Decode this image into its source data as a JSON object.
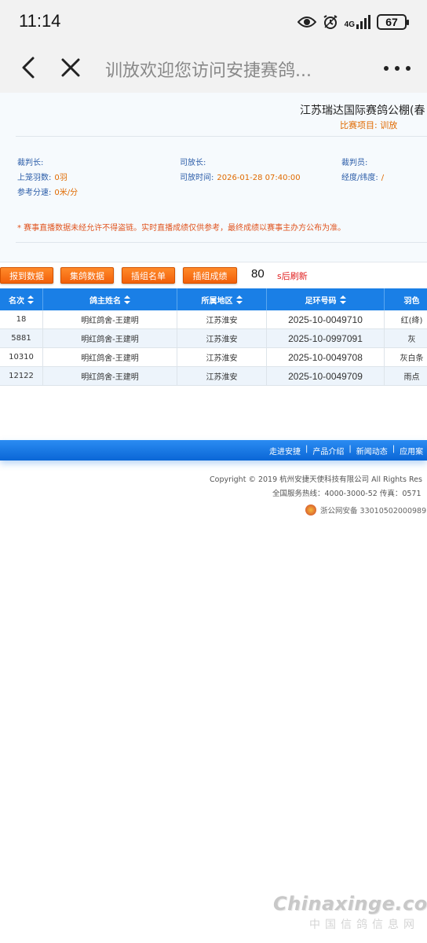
{
  "status_bar": {
    "time": "11:14",
    "network": "4G",
    "battery": "67"
  },
  "browser": {
    "title": "训放欢迎您访问安捷赛鸽..."
  },
  "race": {
    "title": "江苏瑞达国际赛鸽公棚(春",
    "item_label": "比赛项目:",
    "item_value": "训放"
  },
  "fields": {
    "chief_referee_label": "裁判长:",
    "chief_releaser_label": "司放长:",
    "referee_label": "裁判员:",
    "birds_label": "上笼羽数:",
    "birds_value": "0羽",
    "release_time_label": "司放时间:",
    "release_time_value": "2026-01-28 07:40:00",
    "coords_label": "经度/纬度:",
    "coords_value": "/",
    "speed_label": "参考分速:",
    "speed_value": "0米/分"
  },
  "notice": "* 赛事直播数据未经允许不得盗链。实时直播成绩仅供参考，最终成绩以赛事主办方公布为准。",
  "buttons": {
    "report": "报到数据",
    "collect": "集鸽数据",
    "group_list": "插组名单",
    "group_results": "插组成绩"
  },
  "refresh": {
    "seconds": "80",
    "label": "s后刷新"
  },
  "table": {
    "headers": [
      "名次",
      "鸽主姓名",
      "所属地区",
      "足环号码",
      "羽色"
    ],
    "rows": [
      [
        "18",
        "明红鸽舍-王建明",
        "江苏淮安",
        "2025-10-0049710",
        "红(绛)"
      ],
      [
        "5881",
        "明红鸽舍-王建明",
        "江苏淮安",
        "2025-10-0997091",
        "灰"
      ],
      [
        "10310",
        "明红鸽舍-王建明",
        "江苏淮安",
        "2025-10-0049708",
        "灰白条"
      ],
      [
        "12122",
        "明红鸽舍-王建明",
        "江苏淮安",
        "2025-10-0049709",
        "雨点"
      ]
    ]
  },
  "footer": {
    "links": [
      "走进安捷",
      "产品介绍",
      "新闻动态",
      "应用案"
    ],
    "copyright": "Copyright © 2019 杭州安捷天使科技有限公司 All Rights Res",
    "hotline": "全国服务热线：4000-3000-52 传真：0571",
    "beian": "浙公网安备 33010502000989"
  },
  "watermark": {
    "brand": "Chinaxinge.com",
    "sub": "中国信鸽信息网"
  },
  "colors": {
    "accent_blue": "#1a7fe6",
    "button_orange": "#f2600a",
    "label_blue": "#2a5ca8",
    "value_orange": "#e06a00",
    "notice_red": "#e0541f"
  }
}
